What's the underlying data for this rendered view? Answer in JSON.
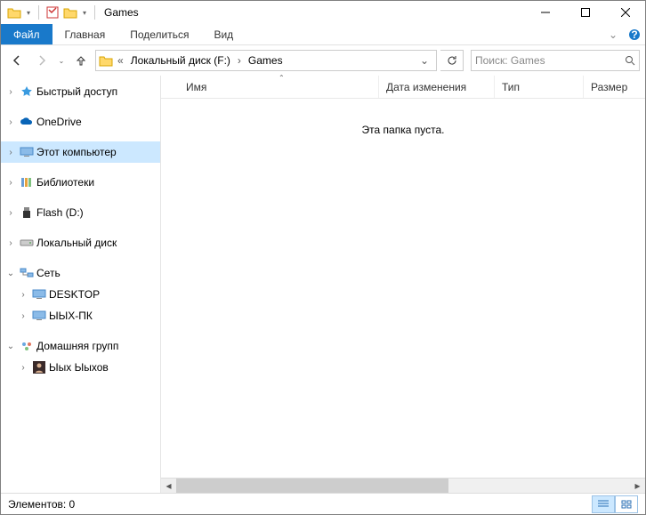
{
  "title": "Games",
  "ribbon": {
    "file": "Файл",
    "tabs": [
      "Главная",
      "Поделиться",
      "Вид"
    ]
  },
  "breadcrumb": {
    "parent": "Локальный диск (F:)",
    "current": "Games"
  },
  "search": {
    "placeholder": "Поиск: Games"
  },
  "columns": {
    "name": "Имя",
    "date": "Дата изменения",
    "type": "Тип",
    "size": "Размер"
  },
  "empty_msg": "Эта папка пуста.",
  "nav": {
    "quick": "Быстрый доступ",
    "onedrive": "OneDrive",
    "thispc": "Этот компьютер",
    "libraries": "Библиотеки",
    "flash": "Flash (D:)",
    "localdisk": "Локальный диск",
    "network": "Сеть",
    "desktop": "DESKTOP",
    "yihpc": "ЫЫХ-ПК",
    "homegroup": "Домашняя групп",
    "user": "Ыых Ыыхов"
  },
  "status": "Элементов: 0"
}
